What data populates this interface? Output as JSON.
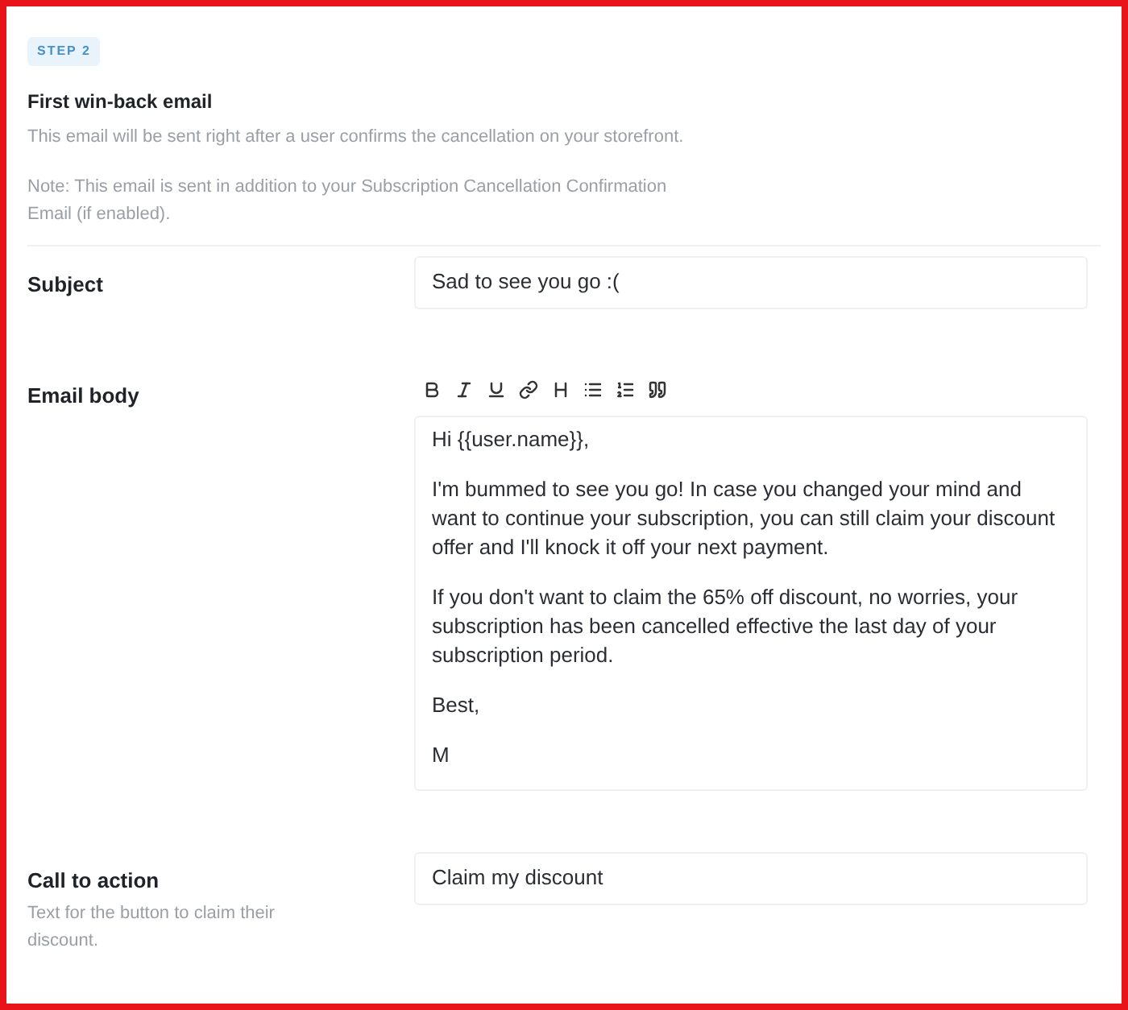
{
  "step_badge": "STEP 2",
  "title": "First win-back email",
  "description": "This email will be sent right after a user confirms the cancellation on your storefront.",
  "note": "Note: This email is sent in addition to your Subscription Cancellation Confirmation Email (if enabled).",
  "fields": [
    {
      "kind": "input",
      "label": "Subject",
      "value": "Sad to see you go :("
    },
    {
      "kind": "editor",
      "label": "Email body",
      "paragraphs": [
        "Hi {{user.name}},",
        "I'm bummed to see you go! In case you changed your mind and want to continue your subscription, you can still claim your discount offer and I'll knock it off your next payment.",
        "If you don't want to claim the 65% off discount, no worries, your subscription has been cancelled effective the last day of your subscription period.",
        "Best,",
        "M"
      ]
    },
    {
      "kind": "input",
      "label": "Call to action",
      "help": "Text for the button to claim their discount.",
      "value": "Claim my discount"
    }
  ]
}
